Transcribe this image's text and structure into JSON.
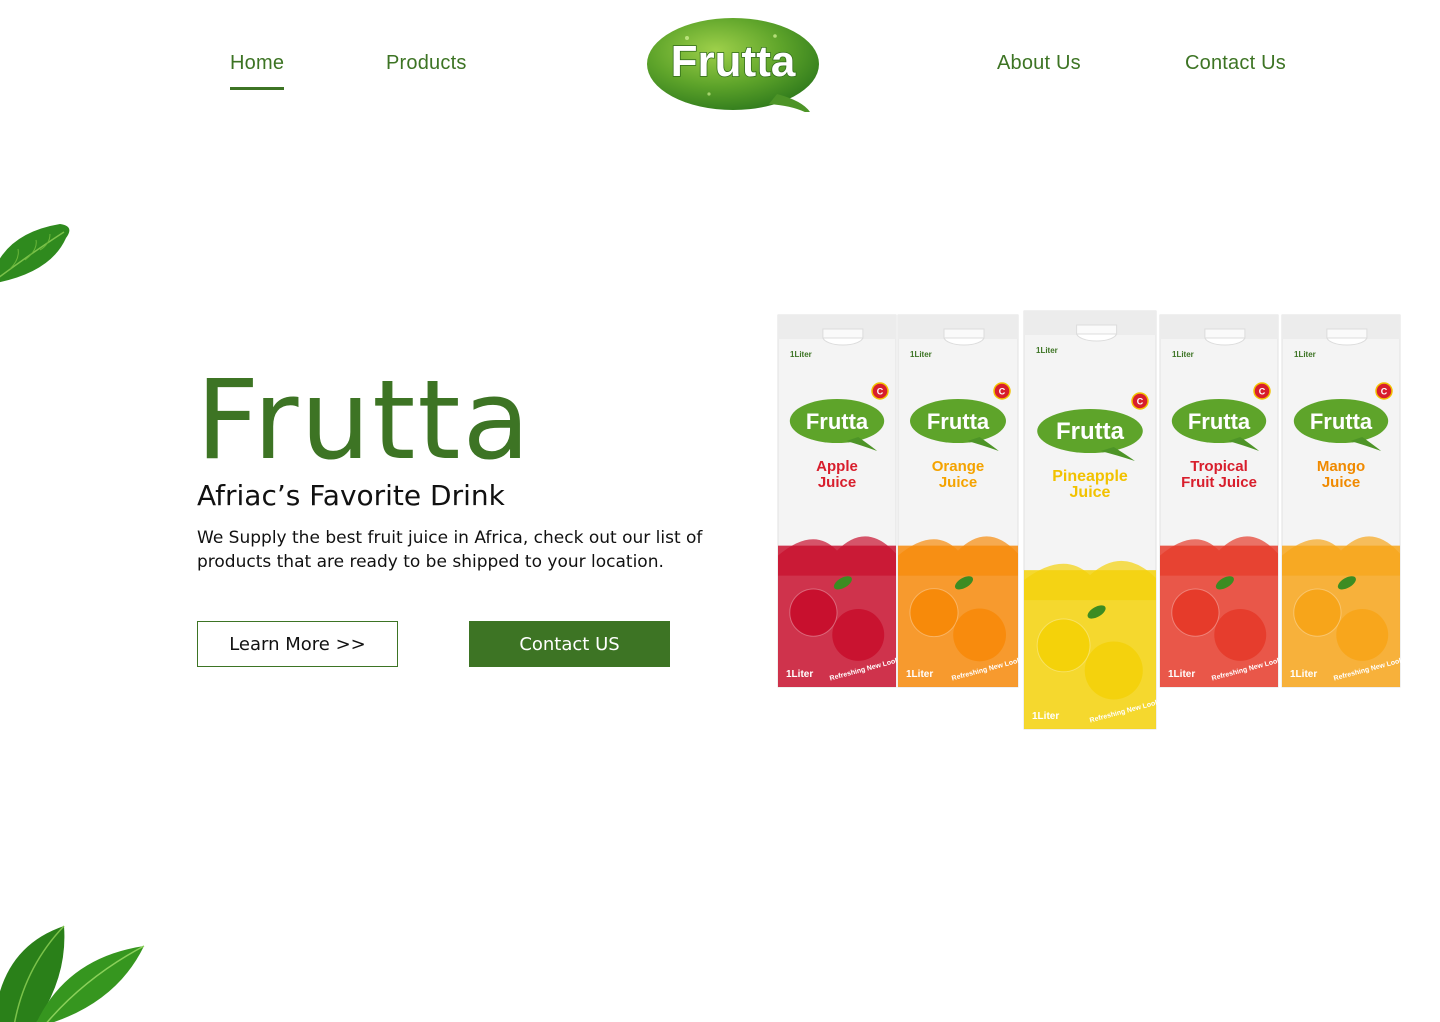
{
  "nav": {
    "home": "Home",
    "products": "Products",
    "about": "About Us",
    "contact": "Contact Us"
  },
  "logo": {
    "text": "Frutta"
  },
  "hero": {
    "title": "Frutta",
    "subtitle": "Afriac’s Favorite Drink",
    "description": "We Supply the best fruit juice in Africa, check out our list of products that are ready to be shipped to your location.",
    "learn_more": "Learn More >>",
    "contact_button": "Contact US"
  },
  "products": [
    {
      "brand": "Frutta",
      "flavor_line1": "Apple",
      "flavor_line2": "Juice",
      "volume": "1Liter",
      "tagline": "Refreshing New Look!",
      "flavor_color": "#d81e2c",
      "fruit_color": "#c8102e"
    },
    {
      "brand": "Frutta",
      "flavor_line1": "Orange",
      "flavor_line2": "Juice",
      "volume": "1Liter",
      "tagline": "Refreshing New Look!",
      "flavor_color": "#f4a300",
      "fruit_color": "#f78a0a"
    },
    {
      "brand": "Frutta",
      "flavor_line1": "Pineapple",
      "flavor_line2": "Juice",
      "volume": "1Liter",
      "tagline": "Refreshing New Look!",
      "flavor_color": "#f2c200",
      "fruit_color": "#f4d20a"
    },
    {
      "brand": "Frutta",
      "flavor_line1": "Tropical",
      "flavor_line2": "Fruit Juice",
      "volume": "1Liter",
      "tagline": "Refreshing New Look!",
      "flavor_color": "#d81e2c",
      "fruit_color": "#e63b2a"
    },
    {
      "brand": "Frutta",
      "flavor_line1": "Mango",
      "flavor_line2": "Juice",
      "volume": "1Liter",
      "tagline": "Refreshing New Look!",
      "flavor_color": "#f08a00",
      "fruit_color": "#f7a51a"
    }
  ],
  "colors": {
    "brand_green": "#3d7424",
    "text_dark": "#111111",
    "background": "#ffffff"
  }
}
